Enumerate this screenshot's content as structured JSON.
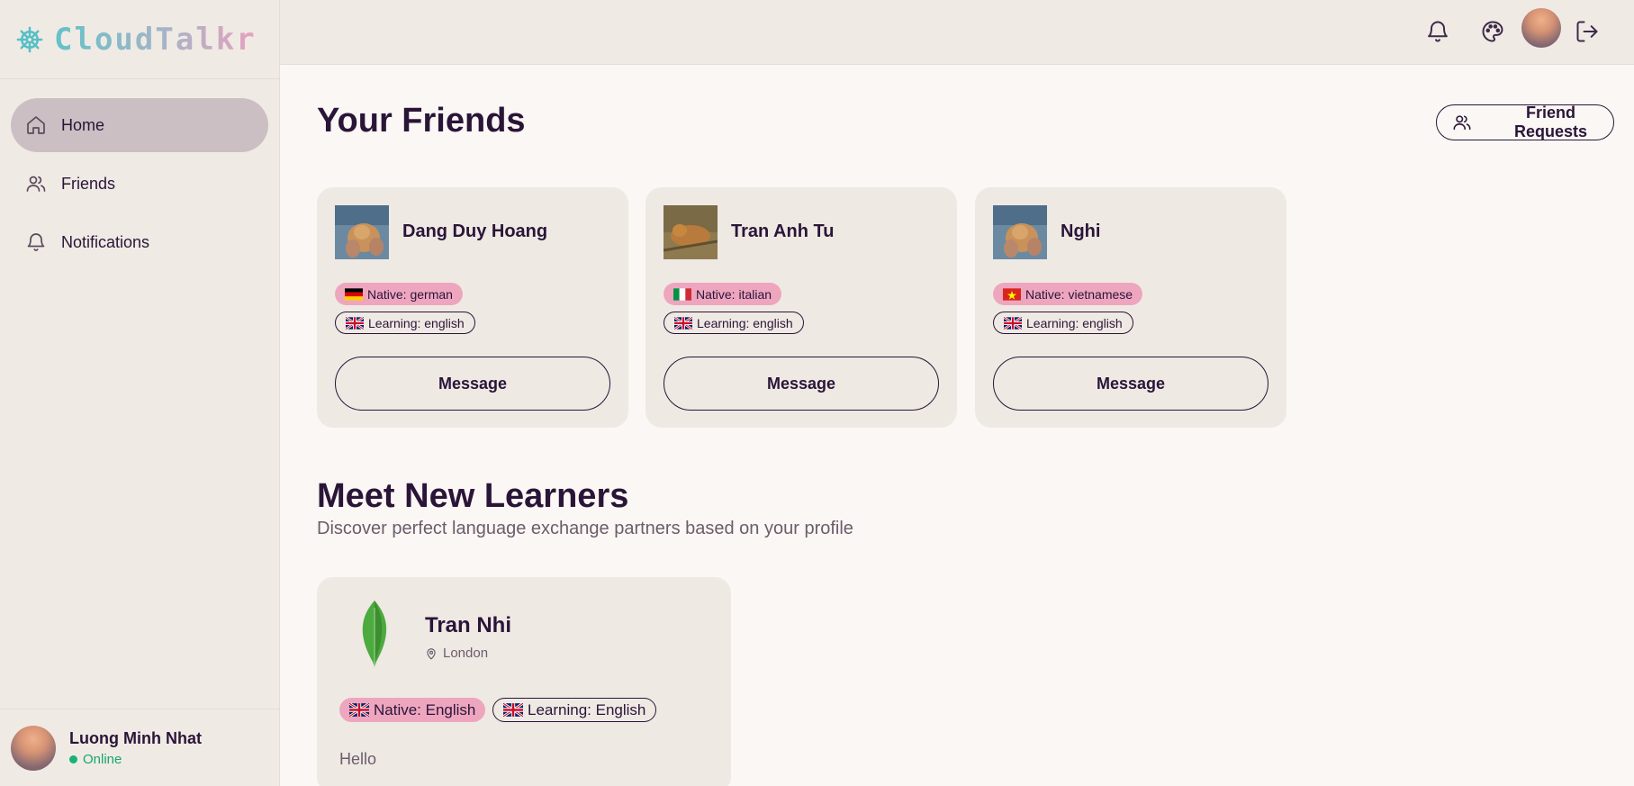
{
  "app": {
    "name": "CloudTalkr",
    "brand_gradient": [
      "#62c2c8",
      "#e7a1bf"
    ],
    "accent_pink": "#eea6bf",
    "online_color": "#16b27a"
  },
  "sidebar": {
    "items": [
      {
        "label": "Home",
        "icon": "home-icon",
        "active": true
      },
      {
        "label": "Friends",
        "icon": "users-icon",
        "active": false
      },
      {
        "label": "Notifications",
        "icon": "bell-icon",
        "active": false
      }
    ],
    "user": {
      "name": "Luong Minh Nhat",
      "status": "Online"
    }
  },
  "topbar": {
    "icons": [
      "bell-icon",
      "palette-icon",
      "avatar",
      "logout-icon"
    ]
  },
  "friends_section": {
    "title": "Your Friends",
    "friend_requests_label": "Friend Requests",
    "friends": [
      {
        "name": "Dang Duy Hoang",
        "native": "Native: german",
        "native_flag": "de",
        "learning": "Learning: english",
        "learning_flag": "gb",
        "message_label": "Message"
      },
      {
        "name": "Tran Anh Tu",
        "native": "Native: italian",
        "native_flag": "it",
        "learning": "Learning: english",
        "learning_flag": "gb",
        "message_label": "Message"
      },
      {
        "name": "Nghi",
        "native": "Native: vietnamese",
        "native_flag": "vn",
        "learning": "Learning: english",
        "learning_flag": "gb",
        "message_label": "Message"
      }
    ]
  },
  "learners_section": {
    "title": "Meet New Learners",
    "subtitle": "Discover perfect language exchange partners based on your profile",
    "learners": [
      {
        "name": "Tran Nhi",
        "location": "London",
        "native": "Native: English",
        "learning": "Learning: English",
        "bio": "Hello"
      }
    ]
  }
}
